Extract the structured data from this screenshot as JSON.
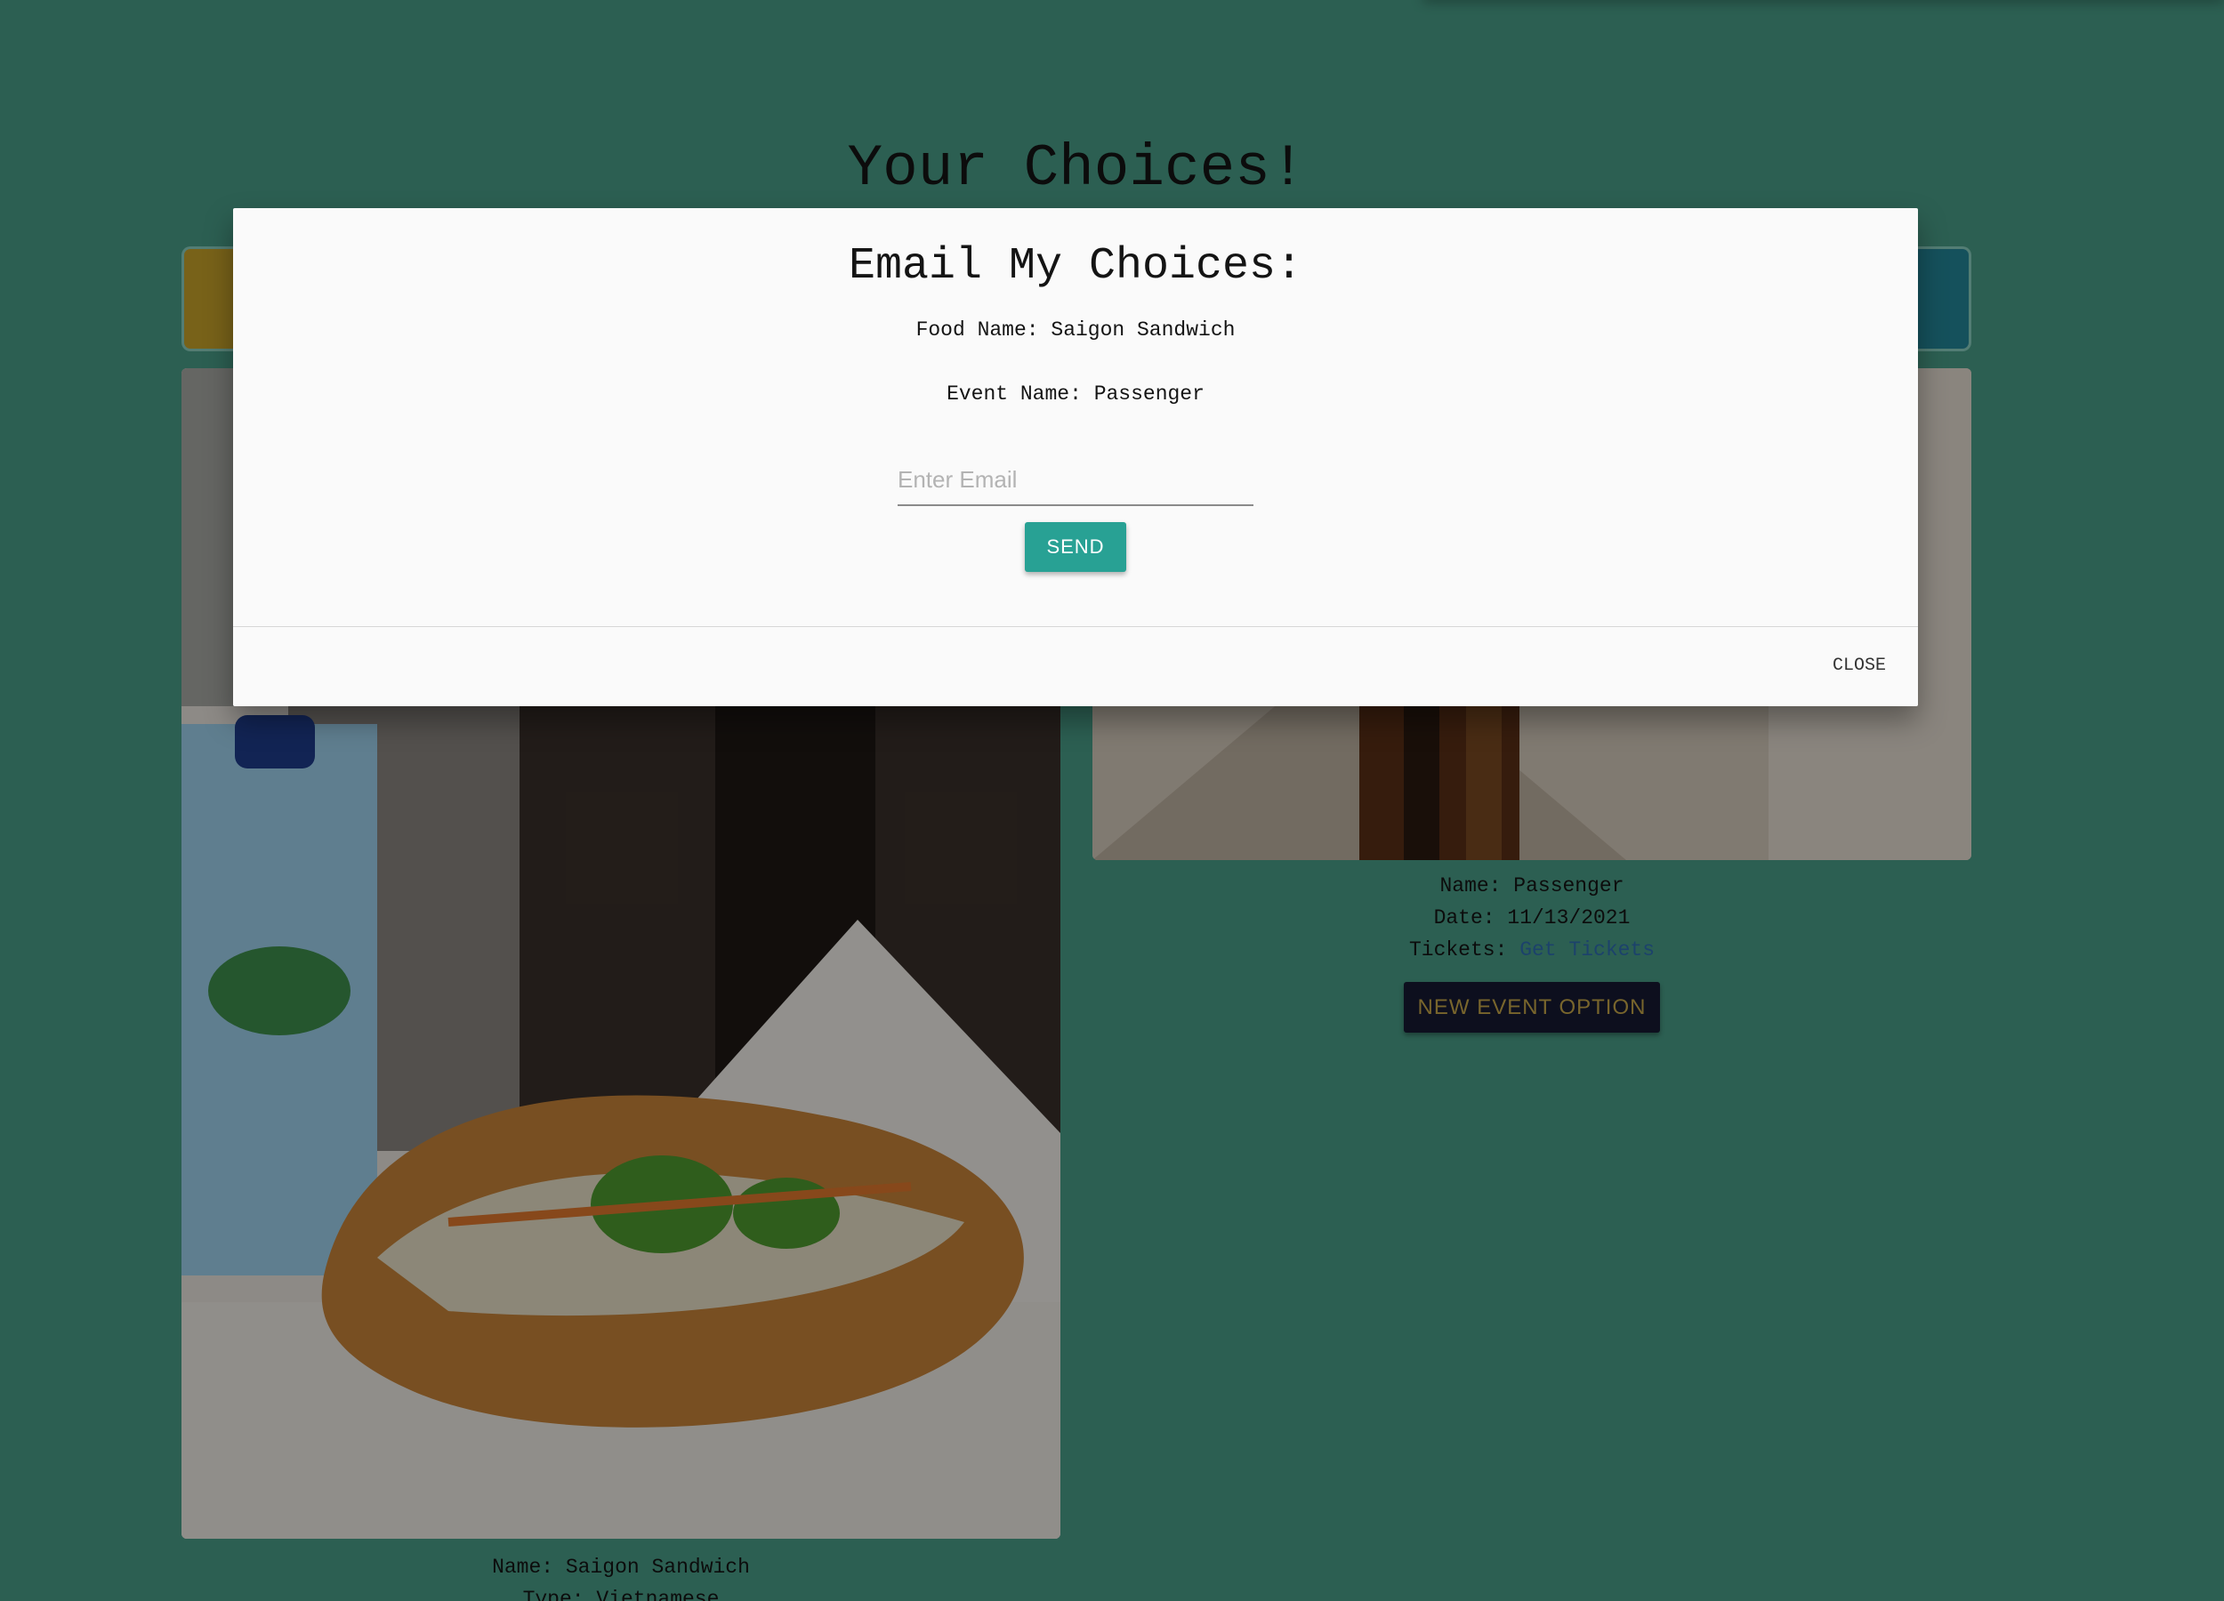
{
  "page": {
    "title": "Your Choices!"
  },
  "food_card": {
    "name_line": "Name: Saigon Sandwich",
    "type_line": "Type: Vietnamese"
  },
  "event_card": {
    "name_line": "Name: Passenger",
    "date_line": "Date: 11/13/2021",
    "tickets_label": "Tickets: ",
    "tickets_link": "Get Tickets",
    "new_option_button": "NEW EVENT OPTION"
  },
  "email_modal": {
    "title": "Email My Choices:",
    "food_line": "Food Name: Saigon Sandwich",
    "event_line": "Event Name: Passenger",
    "email_placeholder": "Enter Email",
    "send_button": "SEND",
    "close_button": "CLOSE"
  },
  "colors": {
    "background": "#4a9f89",
    "primary_button": "#28a194",
    "event_button_bg": "#171a33",
    "event_button_text": "#c9a94a",
    "link": "#2f6fb3"
  }
}
